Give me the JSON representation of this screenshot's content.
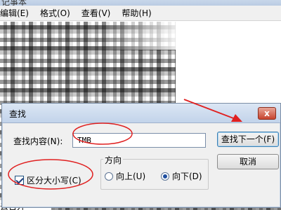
{
  "notepad": {
    "title": "记事本",
    "menus": [
      "编辑(E)",
      "格式(O)",
      "查看(V)",
      "帮助(H)"
    ],
    "bottom_text": "去吉开 ~~\"'"
  },
  "find_dialog": {
    "title": "查找",
    "close_label": "x",
    "find_label": "查找内容(N):",
    "find_value": "TMB",
    "find_next_label": "查找下一个(F)",
    "cancel_label": "取消",
    "direction_label": "方向",
    "up_label": "向上(U)",
    "down_label": "向下(D)",
    "match_case_label": "区分大小写(C)",
    "match_case_checked": true,
    "direction_selected": "down"
  },
  "annotations": {
    "color": "#e02020"
  }
}
